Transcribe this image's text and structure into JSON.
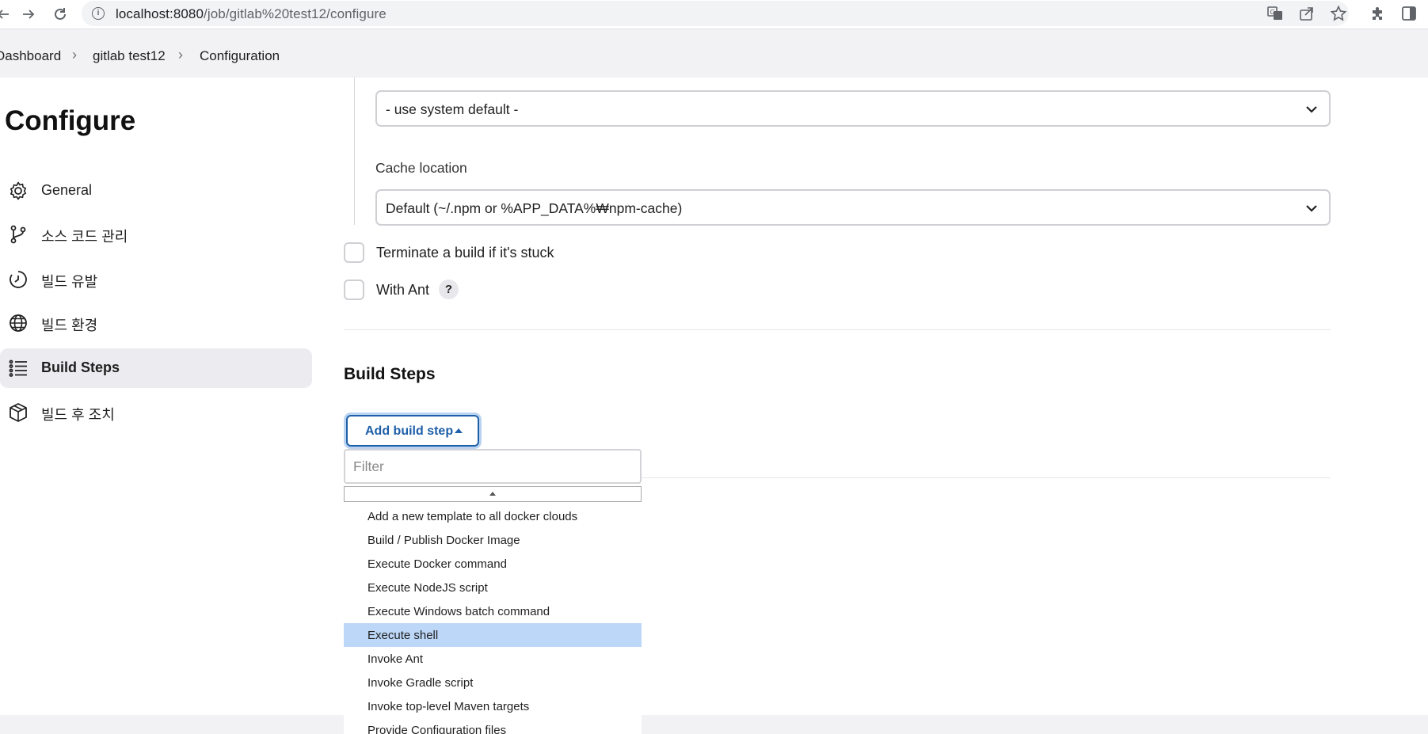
{
  "browser": {
    "url_host": "localhost:8080",
    "url_path": "/job/gitlab%20test12/configure",
    "icons": [
      "back-arrow-icon",
      "forward-arrow-icon",
      "reload-icon",
      "info-icon",
      "translate-icon",
      "share-icon",
      "star-icon",
      "extensions-icon",
      "side-panel-icon"
    ]
  },
  "breadcrumb": {
    "items": [
      "Dashboard",
      "gitlab test12",
      "Configuration"
    ]
  },
  "sidebar": {
    "title": "Configure",
    "items": [
      {
        "label": "General",
        "icon": "gear-icon"
      },
      {
        "label": "소스 코드 관리",
        "icon": "source-branch-icon"
      },
      {
        "label": "빌드 유발",
        "icon": "timer-icon"
      },
      {
        "label": "빌드 환경",
        "icon": "globe-icon"
      },
      {
        "label": "Build Steps",
        "icon": "list-icon",
        "active": true
      },
      {
        "label": "빌드 후 조치",
        "icon": "package-icon"
      }
    ]
  },
  "main": {
    "npm_registry_select": "- use system default -",
    "cache_location_label": "Cache location",
    "cache_location_select": "Default (~/.npm or %APP_DATA%₩npm-cache)",
    "checkboxes": [
      {
        "label": "Terminate a build if it's stuck",
        "checked": false
      },
      {
        "label": "With Ant",
        "checked": false
      }
    ],
    "help_label": "?",
    "build_steps_title": "Build Steps",
    "add_build_step_label": "Add build step"
  },
  "dropdown": {
    "filter_placeholder": "Filter",
    "items": [
      "Add a new template to all docker clouds",
      "Build / Publish Docker Image",
      "Execute Docker command",
      "Execute NodeJS script",
      "Execute Windows batch command",
      "Execute shell",
      "Invoke Ant",
      "Invoke Gradle script",
      "Invoke top-level Maven targets",
      "Provide Configuration files"
    ],
    "selected": "Execute shell"
  },
  "colors": {
    "accent": "#1e5fa8",
    "selected_item": "#bcd7f7",
    "active_sidebar": "#ebebf0",
    "breadcrumb_bg": "#f2f2f5"
  }
}
